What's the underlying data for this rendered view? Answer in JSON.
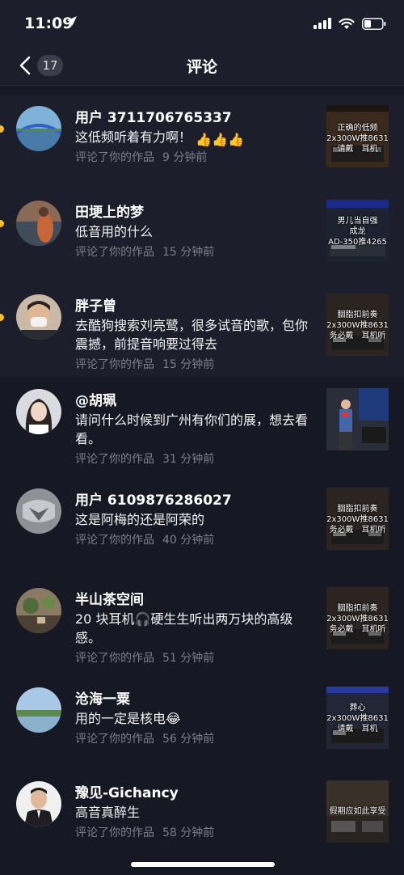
{
  "status_bar": {
    "time": "11:09"
  },
  "nav": {
    "badge": "17",
    "title": "评论"
  },
  "comments": [
    {
      "user": "用户 3711706765337",
      "text": "这低频听着有力啊！",
      "action": "评论了你的作品",
      "time": "9 分钟前",
      "thumb_text": "正确的低频\n2x300W推8631\n请戴　耳机",
      "unread": true
    },
    {
      "user": "田埂上的梦",
      "text": "低音用的什么",
      "action": "评论了你的作品",
      "time": "15 分钟前",
      "thumb_text": "男儿当自强\n成龙\nAD-350推4265",
      "unread": true
    },
    {
      "user": "胖子曾",
      "text": "去酷狗搜索刘亮鹭，很多试音的歌，包你震撼，前提音响要过得去",
      "action": "评论了你的作品",
      "time": "15 分钟前",
      "thumb_text": "胭脂扣前奏\n2x300W推8631\n务必戴　耳机听",
      "unread": true
    },
    {
      "user": "@胡珮",
      "text": "请问什么时候到广州有你们的展，想去看看。",
      "action": "评论了你的作品",
      "time": "31 分钟前",
      "thumb_text": "",
      "unread": false
    },
    {
      "user": "用户 6109876286027",
      "text": "这是阿梅的还是阿荣的",
      "action": "评论了你的作品",
      "time": "40 分钟前",
      "thumb_text": "胭脂扣前奏\n2x300W推8631\n务必戴　耳机听",
      "unread": false
    },
    {
      "user": "半山茶空间",
      "text": "20 块耳机🎧硬生生听出两万块的高级感。",
      "action": "评论了你的作品",
      "time": "51 分钟前",
      "thumb_text": "胭脂扣前奏\n2x300W推8631\n务必戴　耳机听",
      "unread": false
    },
    {
      "user": "沧海一粟",
      "text": "用的一定是核电😂",
      "action": "评论了你的作品",
      "time": "56 分钟前",
      "thumb_text": "葬心\n2x300W推8631\n请戴　耳机",
      "unread": false
    },
    {
      "user": "豫见-Gichancy",
      "text": "高音真醉生",
      "action": "评论了你的作品",
      "time": "58 分钟前",
      "thumb_text": "假期应如此享受",
      "unread": false
    }
  ],
  "colors": {
    "background": "#161823",
    "unread_background": "#1c1e2b",
    "unread_dot": "#fbbf2c",
    "meta_text": "#7c7e88"
  }
}
